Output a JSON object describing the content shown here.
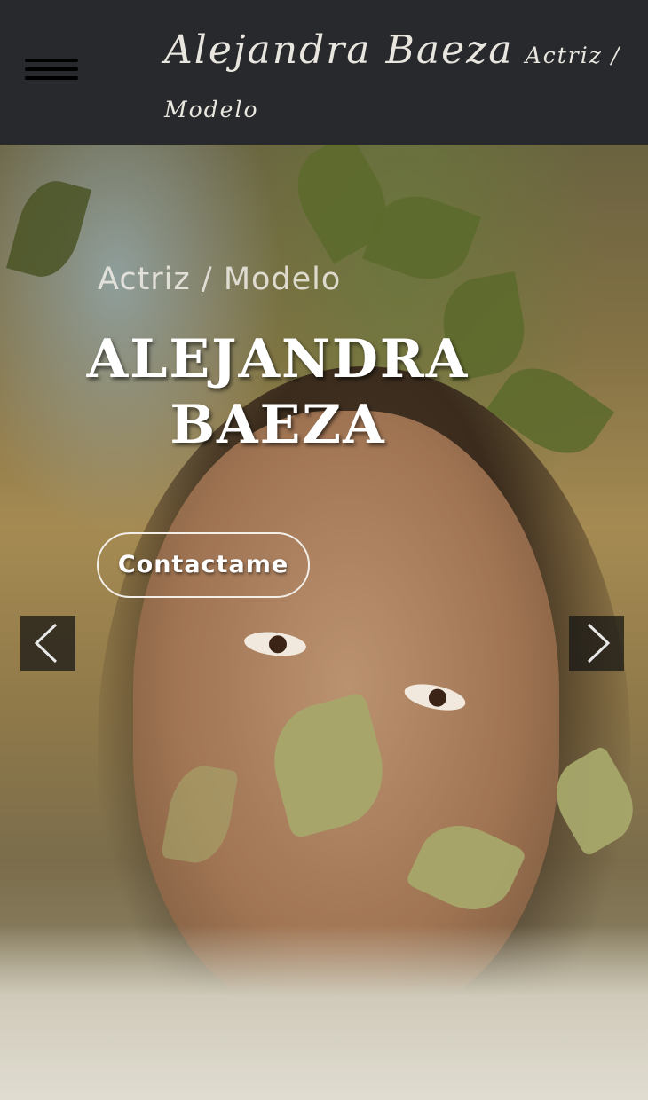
{
  "header": {
    "brand_name": "Alejandra Baeza",
    "brand_role": "Actriz / Modelo",
    "menu_icon": "hamburger-menu-icon"
  },
  "hero": {
    "subtitle": "Actriz / Modelo",
    "headline": "ALEJANDRA BAEZA",
    "cta_label": "Contactame",
    "prev_icon": "chevron-left-icon",
    "next_icon": "chevron-right-icon"
  },
  "colors": {
    "header_bg": "#28292c",
    "brand_text": "#e9e6df",
    "headline_text": "#ffffff"
  }
}
